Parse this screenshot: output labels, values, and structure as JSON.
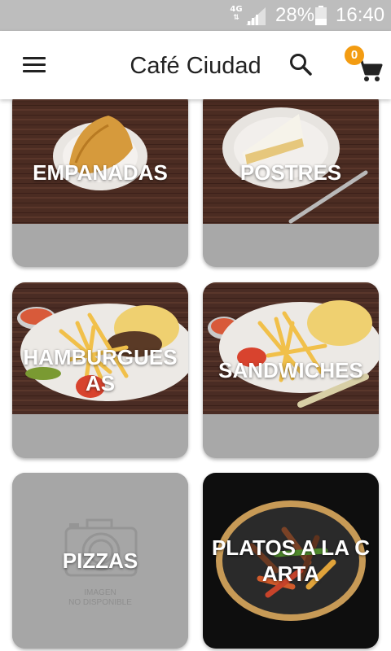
{
  "status_bar": {
    "network": "4G",
    "battery_percent": "28%",
    "time": "16:40"
  },
  "app_bar": {
    "title": "Café Ciudad",
    "cart_count": "0"
  },
  "icons": {
    "menu": "menu-icon",
    "search": "search-icon",
    "cart": "cart-icon"
  },
  "colors": {
    "status_bar": "#bdbdbd",
    "badge": "#f39c12",
    "card_footer": "#a8a8a8"
  },
  "categories": [
    {
      "label": "EMPANADAS"
    },
    {
      "label": "POSTRES"
    },
    {
      "label": "HAMBURGUESAS"
    },
    {
      "label": "SANDWICHES"
    },
    {
      "label": "PIZZAS",
      "placeholder_text": [
        "IMAGEN",
        "NO DISPONIBLE"
      ]
    },
    {
      "label": "PLATOS A LA CARTA"
    }
  ]
}
